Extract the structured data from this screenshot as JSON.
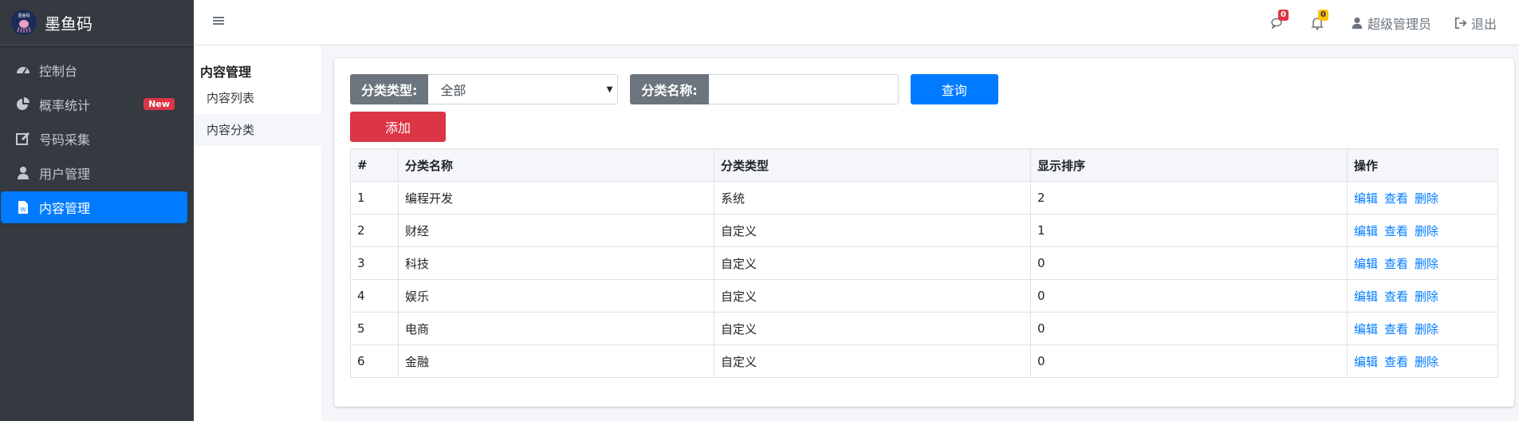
{
  "app": {
    "brand": "墨鱼码",
    "logo_text": "墨鱼码"
  },
  "sidebar": {
    "items": [
      {
        "label": "控制台",
        "icon": "dashboard-icon"
      },
      {
        "label": "概率统计",
        "icon": "pie-chart-icon",
        "badge": "New"
      },
      {
        "label": "号码采集",
        "icon": "edit-icon"
      },
      {
        "label": "用户管理",
        "icon": "user-icon"
      },
      {
        "label": "内容管理",
        "icon": "document-icon",
        "active": true
      }
    ]
  },
  "topbar": {
    "messages_count": "0",
    "notifications_count": "0",
    "user_name": "超级管理员",
    "logout_label": "退出"
  },
  "submenu": {
    "title": "内容管理",
    "items": [
      {
        "label": "内容列表"
      },
      {
        "label": "内容分类",
        "active": true
      }
    ]
  },
  "filters": {
    "type_label": "分类类型:",
    "type_value": "全部",
    "name_label": "分类名称:",
    "name_value": "",
    "query_label": "查询",
    "add_label": "添加"
  },
  "table": {
    "headers": [
      "#",
      "分类名称",
      "分类类型",
      "显示排序",
      "操作"
    ],
    "actions": [
      "编辑",
      "查看",
      "删除"
    ],
    "rows": [
      [
        "1",
        "编程开发",
        "系统",
        "2"
      ],
      [
        "2",
        "财经",
        "自定义",
        "1"
      ],
      [
        "3",
        "科技",
        "自定义",
        "0"
      ],
      [
        "4",
        "娱乐",
        "自定义",
        "0"
      ],
      [
        "5",
        "电商",
        "自定义",
        "0"
      ],
      [
        "6",
        "金融",
        "自定义",
        "0"
      ]
    ]
  },
  "colors": {
    "sidebar_bg": "#343a40",
    "primary": "#007bff",
    "danger": "#dc3545",
    "warning": "#ffc107"
  }
}
